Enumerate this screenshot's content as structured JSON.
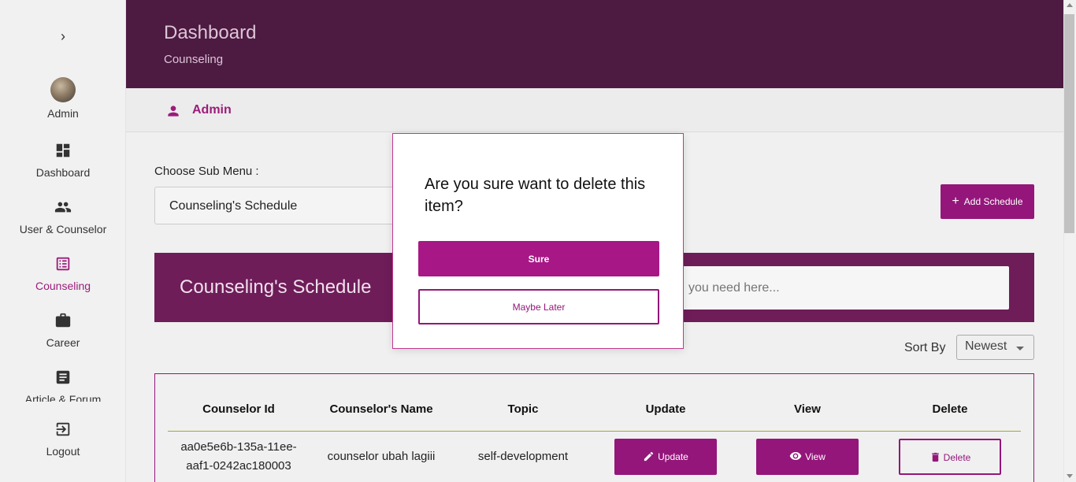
{
  "sidebar": {
    "toggle_glyph": "›",
    "profile": {
      "label": "Admin"
    },
    "items": [
      {
        "label": "Dashboard",
        "icon": "dashboard-icon"
      },
      {
        "label": "User & Counselor",
        "icon": "users-icon"
      },
      {
        "label": "Counseling",
        "icon": "list-icon",
        "active": true
      },
      {
        "label": "Career",
        "icon": "briefcase-icon"
      },
      {
        "label": "Article & Forum",
        "icon": "article-icon"
      },
      {
        "label": "Logout",
        "icon": "logout-icon"
      }
    ]
  },
  "header": {
    "title": "Dashboard",
    "subtitle": "Counseling"
  },
  "userbar": {
    "name": "Admin",
    "icon": "person-icon"
  },
  "main": {
    "submenu_label": "Choose Sub Menu :",
    "submenu_value": "Counseling's Schedule",
    "add_button": "Add Schedule",
    "banner_title": "Counseling's Schedule",
    "search_placeholder": "you need here...",
    "sort_label": "Sort By",
    "sort_value": "Newest"
  },
  "table": {
    "columns": [
      "Counselor Id",
      "Counselor's Name",
      "Topic",
      "Update",
      "View",
      "Delete"
    ],
    "rows": [
      {
        "id_line1": "aa0e5e6b-135a-11ee-",
        "id_line2": "aaf1-0242ac180003",
        "name": "counselor ubah lagiii",
        "topic": "self-development",
        "update": "Update",
        "view": "View",
        "delete": "Delete"
      }
    ]
  },
  "modal": {
    "question": "Are you sure want to delete this item?",
    "confirm": "Sure",
    "cancel": "Maybe Later"
  },
  "colors": {
    "primary": "#94167a",
    "header": "#4d1a42",
    "banner": "#6e1d59"
  }
}
